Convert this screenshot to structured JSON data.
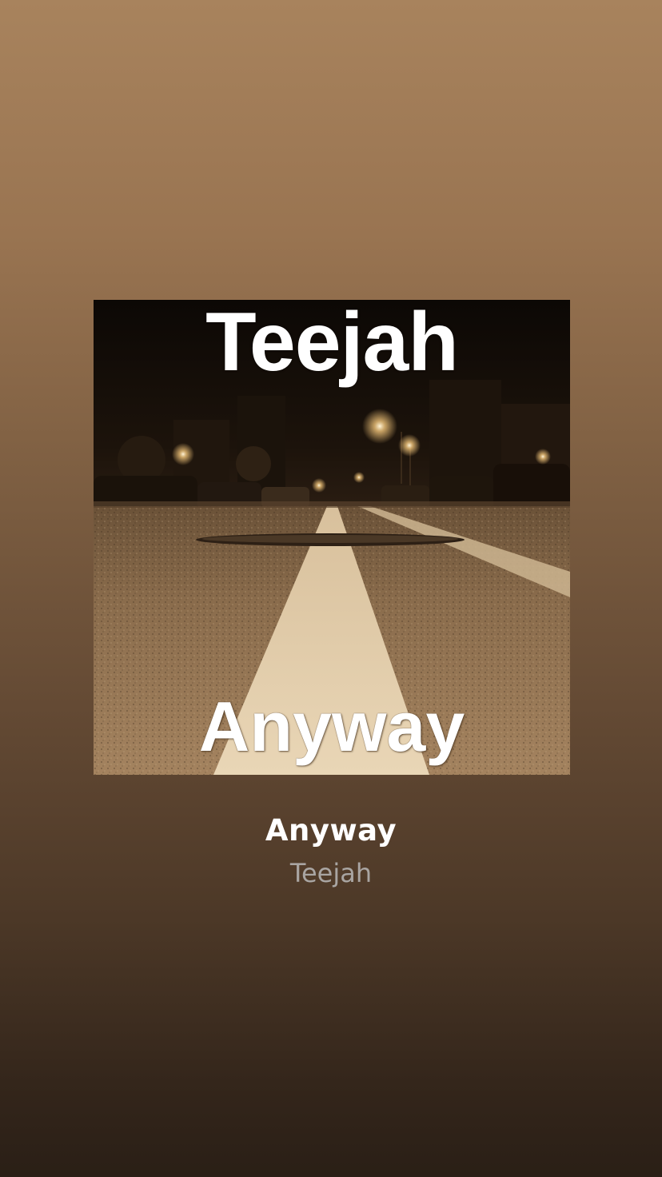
{
  "album_art": {
    "artist_text": "Teejah",
    "title_text": "Anyway"
  },
  "track": {
    "title": "Anyway",
    "artist": "Teejah"
  },
  "colors": {
    "background_top": "#a8835d",
    "background_bottom": "#2a1f16",
    "title": "#ffffff",
    "artist": "#a9a5a2"
  }
}
